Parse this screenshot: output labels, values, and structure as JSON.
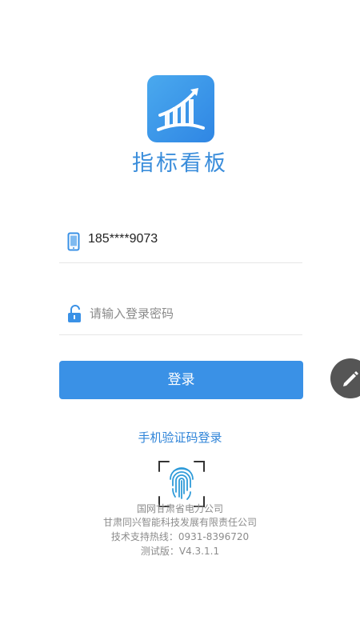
{
  "app": {
    "title": "指标看板"
  },
  "login": {
    "phone_value": "185****9073",
    "password_placeholder": "请输入登录密码",
    "login_button": "登录",
    "sms_login_link": "手机验证码登录"
  },
  "icons": {
    "logo": "chart-arrow-icon",
    "phone": "phone-icon",
    "lock": "unlock-icon",
    "fingerprint": "fingerprint-icon",
    "edit": "pencil-icon"
  },
  "footer": {
    "line1": "国网甘肃省电力公司",
    "line2": "甘肃同兴智能科技发展有限责任公司",
    "line3": "技术支持热线：0931-8396720",
    "line4": "测试版：V4.3.1.1"
  },
  "colors": {
    "accent": "#3a91e6",
    "title": "#3a8ddb",
    "fab": "#555555"
  }
}
